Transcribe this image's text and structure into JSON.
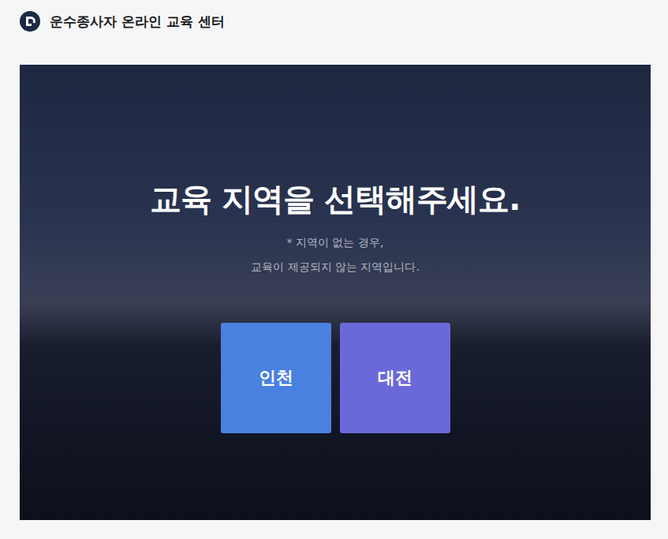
{
  "header": {
    "title": "운수종사자 온라인 교육 센터"
  },
  "hero": {
    "title": "교육 지역을 선택해주세요.",
    "notice": [
      "* 지역이 없는 경우,",
      "교육이 제공되지 않는 지역입니다."
    ]
  },
  "regions": [
    {
      "label": "인천",
      "color": "#4a80e0"
    },
    {
      "label": "대전",
      "color": "#6b69d9"
    }
  ]
}
